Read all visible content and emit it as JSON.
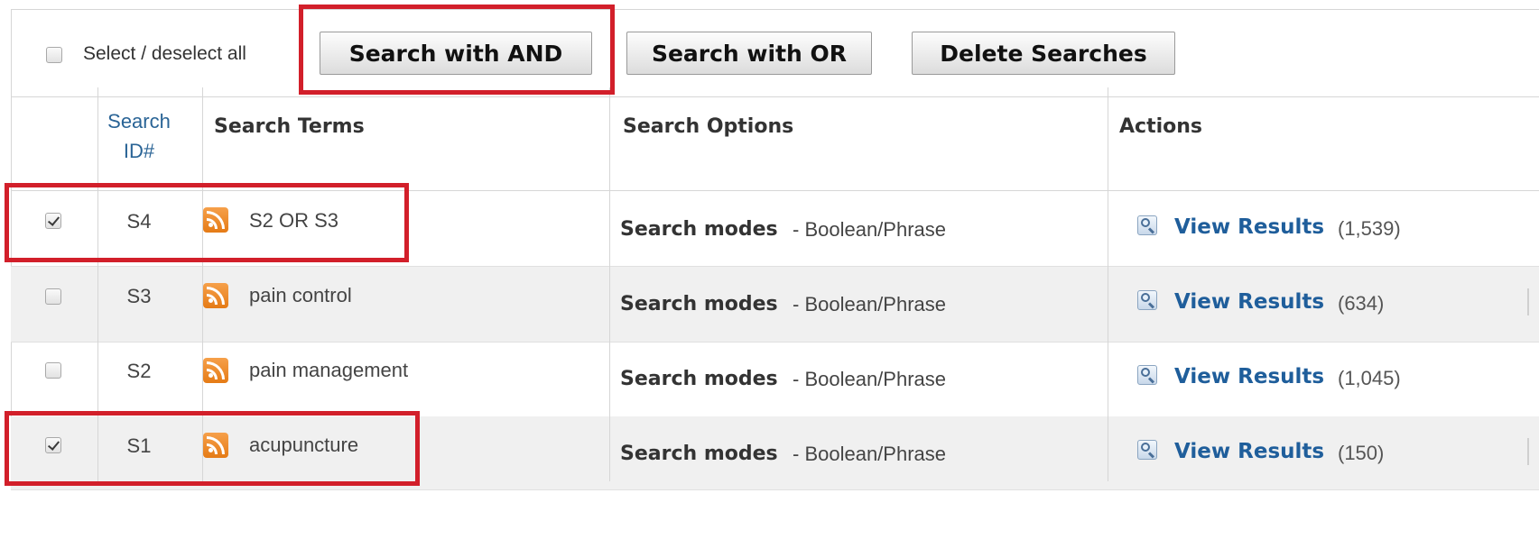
{
  "toolbar": {
    "select_all_label": "Select / deselect all",
    "buttons": {
      "search_and": "Search with AND",
      "search_or": "Search with OR",
      "delete": "Delete Searches"
    }
  },
  "table": {
    "headers": {
      "search_id_line1": "Search",
      "search_id_line2": "ID#",
      "search_terms": "Search Terms",
      "search_options": "Search Options",
      "actions": "Actions"
    },
    "rows": [
      {
        "checked": true,
        "id": "S4",
        "term": "S2 OR S3",
        "option_label": "Search modes",
        "option_value": "- Boolean/Phrase",
        "action": "View Results",
        "count": "(1,539)"
      },
      {
        "checked": false,
        "id": "S3",
        "term": "pain control",
        "option_label": "Search modes",
        "option_value": "- Boolean/Phrase",
        "action": "View Results",
        "count": "(634)"
      },
      {
        "checked": false,
        "id": "S2",
        "term": "pain management",
        "option_label": "Search modes",
        "option_value": "- Boolean/Phrase",
        "action": "View Results",
        "count": "(1,045)"
      },
      {
        "checked": true,
        "id": "S1",
        "term": "acupuncture",
        "option_label": "Search modes",
        "option_value": "- Boolean/Phrase",
        "action": "View Results",
        "count": "(150)"
      }
    ]
  },
  "icons": {
    "row_feed": "rss-feed-icon",
    "view_results": "magnifier-icon"
  },
  "colors": {
    "highlight": "#d21f2a",
    "link": "#1f5e9b",
    "header_id": "#2a6496",
    "alt_row": "#f0f0f0"
  }
}
